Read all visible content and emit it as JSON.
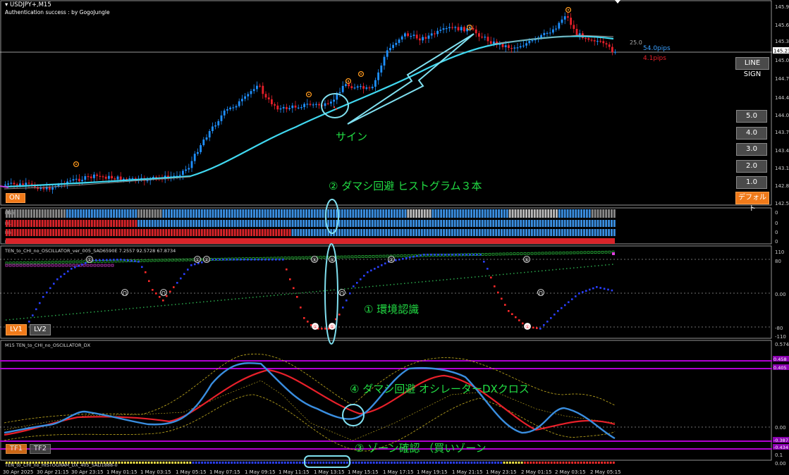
{
  "header": {
    "symbol": "USDJPY+,M15",
    "auth_text": "Authentication success : by GogoJungle"
  },
  "price_axis": {
    "labels": [
      "145.98",
      "145.63",
      "145.35",
      "145.23",
      "145.05",
      "144.72",
      "144.40",
      "144.05",
      "143.78",
      "143.42",
      "143.15",
      "142.82",
      "142.52"
    ],
    "current_price": "145.23"
  },
  "pips": {
    "value_label": "25.0",
    "upper": "54.0pips",
    "lower": "4.1pips"
  },
  "buttons": {
    "line_sign": "LINE SIGN",
    "levels": [
      "5.0",
      "4.0",
      "3.0",
      "2.0",
      "1.0"
    ],
    "default": "デフォルト",
    "on": "ON",
    "lv1": "LV1",
    "lv2": "LV2",
    "tf1": "TF1",
    "tf2": "TF2"
  },
  "mtf_panel": {
    "rows": [
      "M15",
      "H1",
      "H4",
      "D1"
    ],
    "row_values": [
      "0",
      "0",
      "0",
      "0"
    ]
  },
  "osc_panel": {
    "title": "TEN_to_CHI_no_OSCILLATOR_ver_005_SAD6590E 7.2557 92.5728 67.8734",
    "axis_labels": [
      "110",
      "80",
      "0.00",
      "-80",
      "-110"
    ]
  },
  "dx_panel": {
    "title": "M15 TEN_to_CHI_no_OSCILLATOR_DX",
    "axis_labels": [
      "0.574",
      "0.458",
      "0.405",
      "0.00",
      "-0.387",
      "-0.434"
    ]
  },
  "hist_panel": {
    "title": "TEN_to_CHI_no_HISTOGRAM_DX_405_SAD1888-0",
    "axis_labels": [
      "0.1",
      "0.00"
    ]
  },
  "time_axis": {
    "labels": [
      "30 Apr 2025",
      "30 Apr 21:15",
      "30 Apr 23:15",
      "1 May 01:15",
      "1 May 03:15",
      "1 May 05:15",
      "1 May 07:15",
      "1 May 09:15",
      "1 May 11:15",
      "1 May 13:15",
      "1 May 15:15",
      "1 May 17:15",
      "1 May 19:15",
      "1 May 21:15",
      "1 May 23:15",
      "2 May 01:15",
      "2 May 03:15",
      "2 May 05:15"
    ]
  },
  "annotations": {
    "sign": "サイン",
    "dummy_avoid_hist": "② ダマシ回避 ヒストグラム３本",
    "env_recognition": "① 環境認識",
    "dummy_avoid_dx": "④ ダマシ回避 オシレーターDXクロス",
    "zone_confirm": "③ ゾーン確認 （買いゾーン"
  },
  "colors": {
    "up_candle": "#1e90ff",
    "down_candle": "#e8202a",
    "ma_line": "#40d8f0",
    "annotation": "#22dd44",
    "highlight": "#80e0f0",
    "orange_button": "#f07a1a",
    "magenta_band": "#b000d0"
  }
}
